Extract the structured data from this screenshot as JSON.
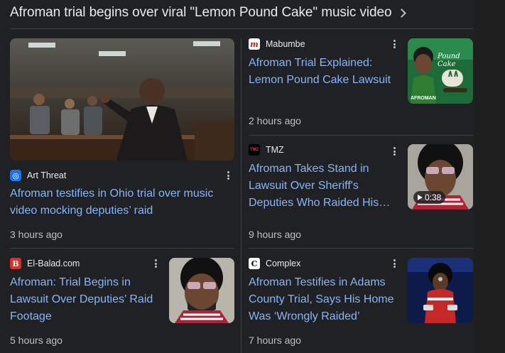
{
  "header": {
    "title": "Afroman trial begins over viral \"Lemon Pound Cake\" music video"
  },
  "cards": [
    {
      "source": "Art Threat",
      "headline_lines": [
        "Afroman testifies in Ohio trial over music",
        "video mocking deputies’ raid"
      ],
      "time": "3 hours ago"
    },
    {
      "source": "El-Balad.com",
      "headline_lines": [
        "Afroman: Trial Begins in",
        "Lawsuit Over Deputies’ Raid",
        "Footage"
      ],
      "time": "5 hours ago"
    },
    {
      "source": "Mabumbe",
      "headline_lines": [
        "Afroman Trial Explained:",
        "Lemon Pound Cake Lawsuit"
      ],
      "time": "2 hours ago",
      "thumb_text": [
        "AFROMAN",
        "Pound Cake"
      ]
    },
    {
      "source": "TMZ",
      "headline_lines": [
        "Afroman Takes Stand in",
        "Lawsuit Over Sheriff's",
        "Deputies Who Raided His…"
      ],
      "time": "9 hours ago",
      "duration": "0:38"
    },
    {
      "source": "Complex",
      "headline_lines": [
        "Afroman Testifies in Adams",
        "County Trial, Says His Home",
        "Was ‘Wrongly Raided’"
      ],
      "time": "7 hours ago"
    }
  ],
  "favicons": {
    "art_threat": "◎",
    "el_balad": "B",
    "mabumbe": "m",
    "tmz": "TMZ",
    "complex": "C"
  },
  "colors": {
    "link": "#8ab4f8",
    "panel": "#202124",
    "text_secondary": "#bdc1c6"
  }
}
